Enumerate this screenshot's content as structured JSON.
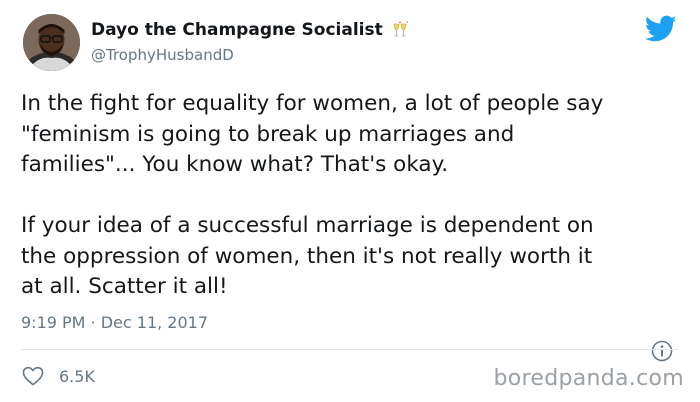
{
  "tweet": {
    "author": {
      "display_name": "Dayo the Champagne Socialist",
      "handle": "@TrophyHusbandD",
      "avatar_icon": "profile-photo",
      "name_emoji": "champagne-glasses-icon"
    },
    "body": {
      "paragraph_1": "In the fight for equality for women, a lot of people say\n\"feminism is going to break up marriages and\nfamilies\"... You know what? That's okay.",
      "paragraph_2": "If your idea of a successful marriage is dependent on\nthe oppression of women, then it's not really worth it\nat all. Scatter it all!"
    },
    "timestamp": "9:19 PM · Dec 11, 2017",
    "likes": "6.5K",
    "brand_icon": "twitter-bird-icon"
  },
  "watermark": "boredpanda.com",
  "colors": {
    "text_primary": "#14171a",
    "text_secondary": "#657786",
    "twitter_blue": "#1da1f2",
    "divider": "#e1e8ed",
    "watermark": "#9aa0a6"
  }
}
